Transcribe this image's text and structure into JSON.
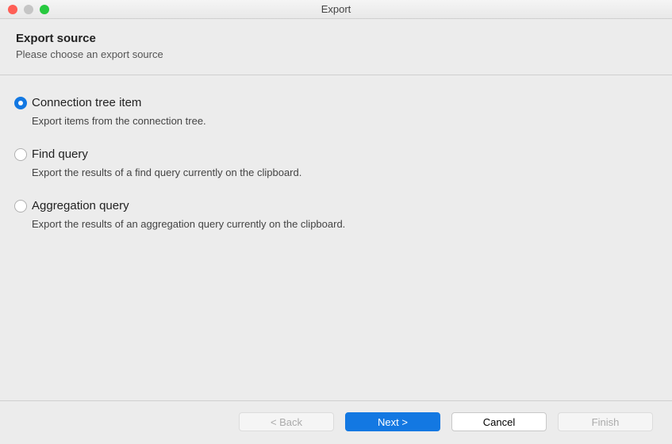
{
  "window": {
    "title": "Export"
  },
  "header": {
    "title": "Export source",
    "subtitle": "Please choose an export source"
  },
  "options": [
    {
      "label": "Connection tree item",
      "desc": "Export items from the connection tree.",
      "selected": true
    },
    {
      "label": "Find query",
      "desc": "Export the results of a find query currently on the clipboard.",
      "selected": false
    },
    {
      "label": "Aggregation query",
      "desc": "Export the results of an aggregation query currently on the clipboard.",
      "selected": false
    }
  ],
  "buttons": {
    "back": "< Back",
    "next": "Next >",
    "cancel": "Cancel",
    "finish": "Finish"
  }
}
